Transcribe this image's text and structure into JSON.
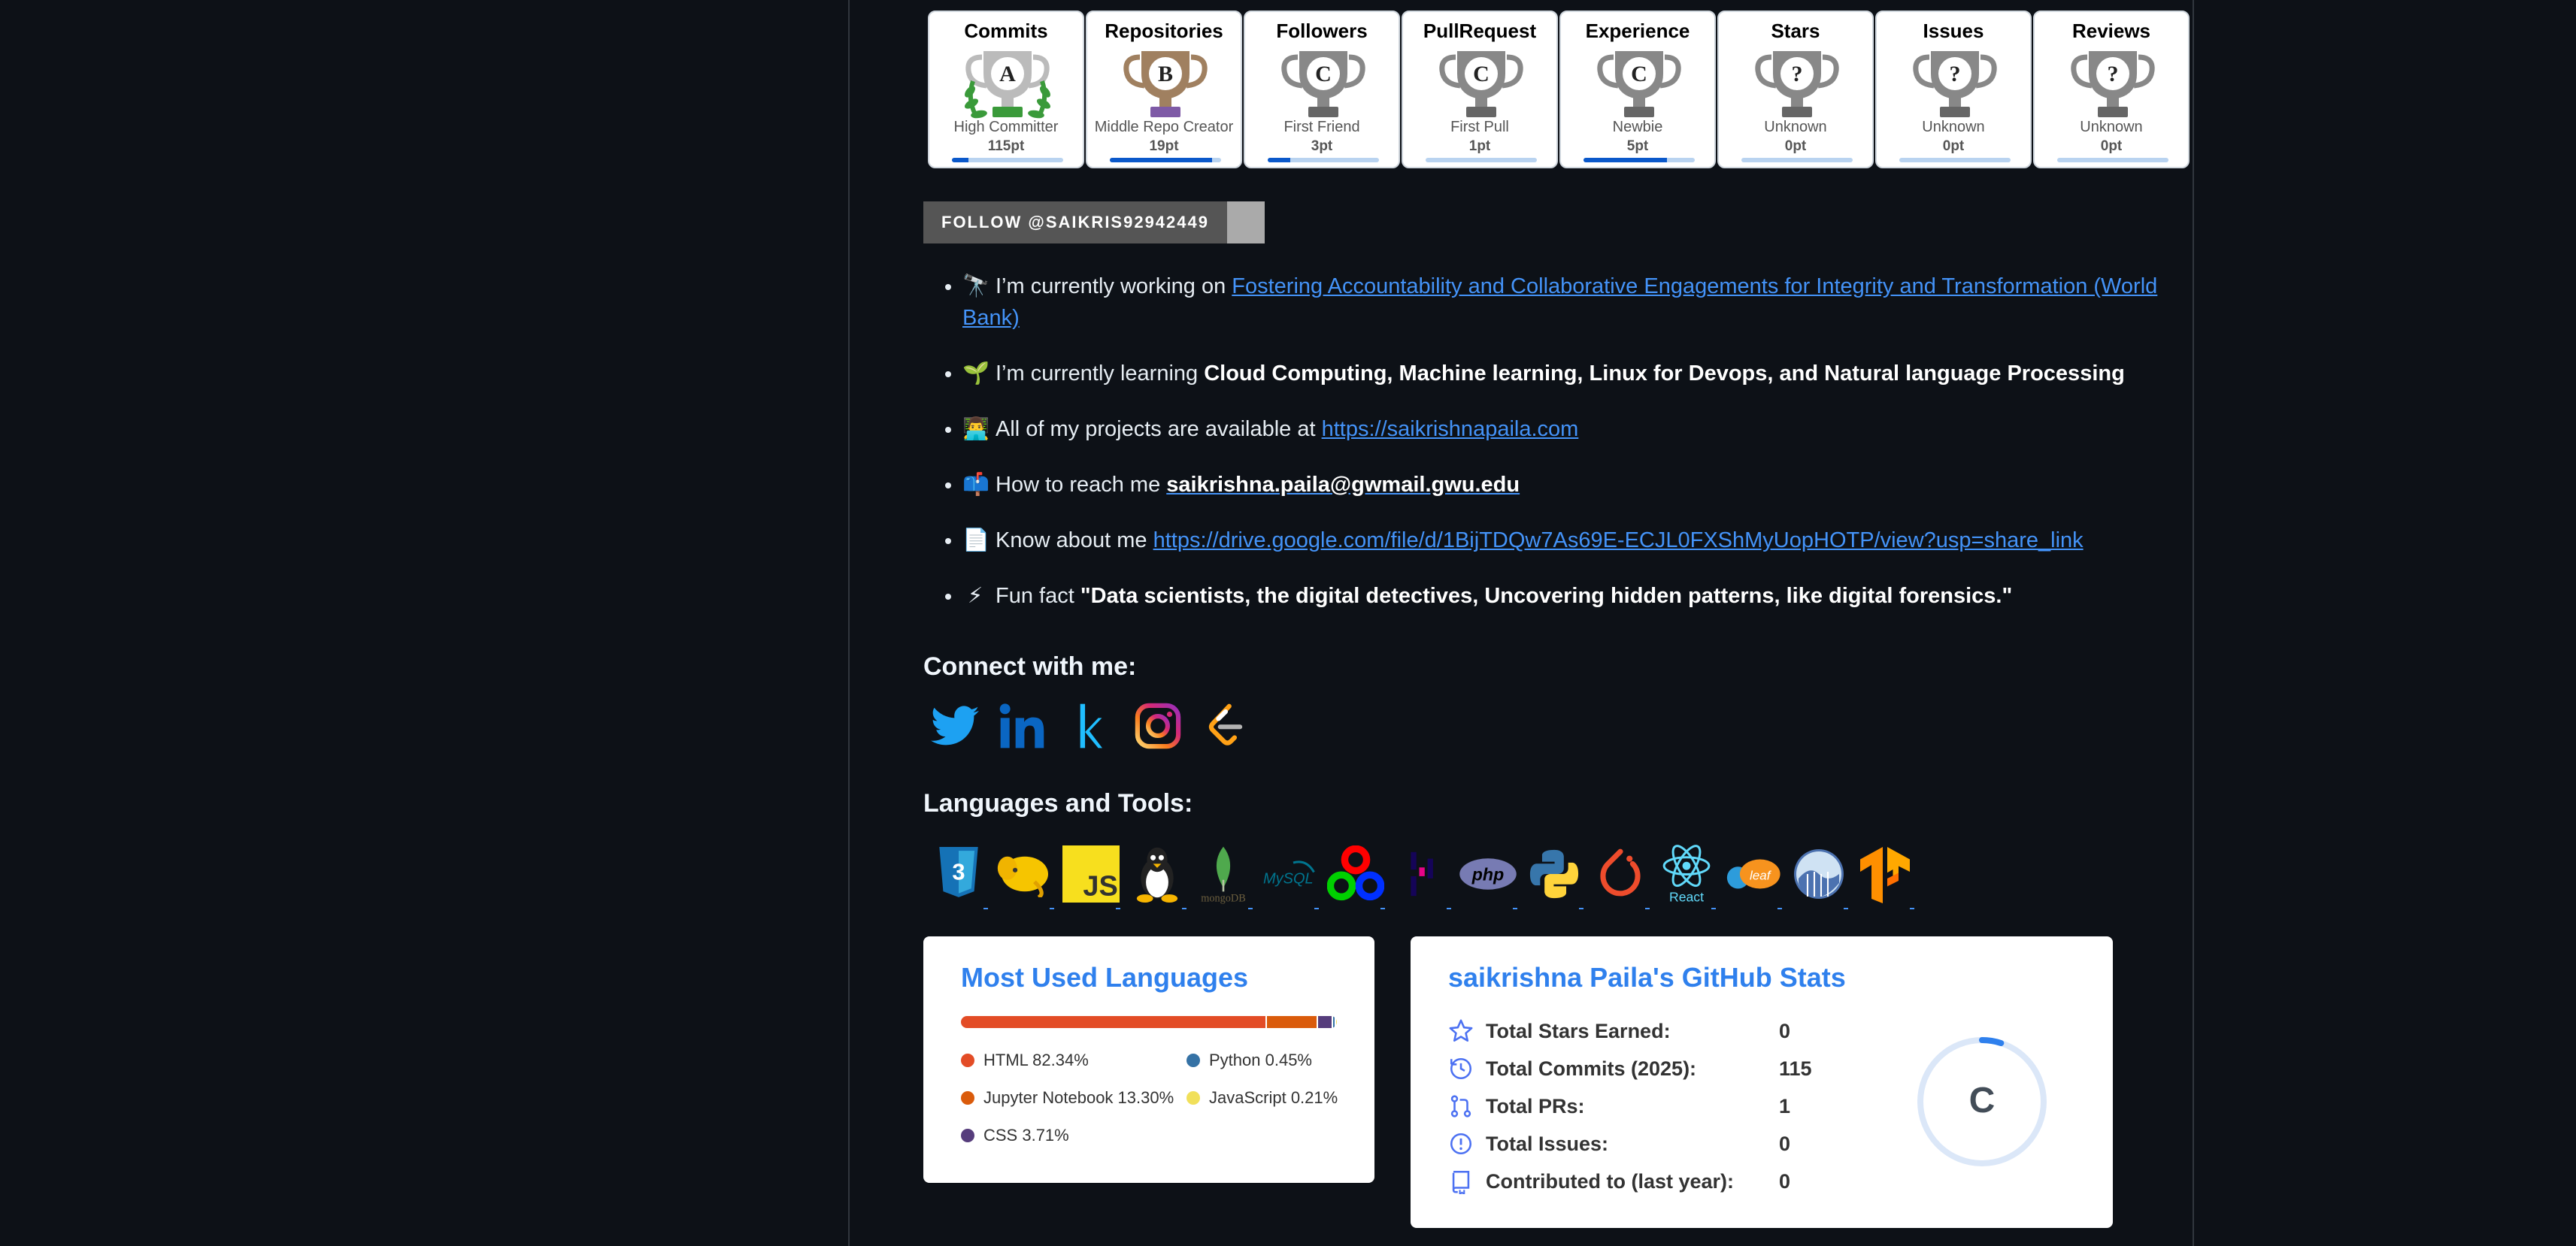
{
  "trophies": [
    {
      "title": "Commits",
      "rank": "A",
      "name": "High Committer",
      "points": "115pt",
      "progress": 0.15,
      "cup": "#bbb",
      "accent": "#3a9a3a",
      "laurel": true
    },
    {
      "title": "Repositories",
      "rank": "B",
      "name": "Middle Repo Creator",
      "points": "19pt",
      "progress": 0.92,
      "cup": "#a08060",
      "accent": "#7e5aa6",
      "laurel": false
    },
    {
      "title": "Followers",
      "rank": "C",
      "name": "First Friend",
      "points": "3pt",
      "progress": 0.2,
      "cup": "#888",
      "accent": "#666",
      "laurel": false
    },
    {
      "title": "PullRequest",
      "rank": "C",
      "name": "First Pull",
      "points": "1pt",
      "progress": 0.0,
      "cup": "#888",
      "accent": "#666",
      "laurel": false
    },
    {
      "title": "Experience",
      "rank": "C",
      "name": "Newbie",
      "points": "5pt",
      "progress": 0.75,
      "cup": "#888",
      "accent": "#666",
      "laurel": false
    },
    {
      "title": "Stars",
      "rank": "?",
      "name": "Unknown",
      "points": "0pt",
      "progress": 0.0,
      "cup": "#888",
      "accent": "#666",
      "laurel": false
    },
    {
      "title": "Issues",
      "rank": "?",
      "name": "Unknown",
      "points": "0pt",
      "progress": 0.0,
      "cup": "#888",
      "accent": "#666",
      "laurel": false
    },
    {
      "title": "Reviews",
      "rank": "?",
      "name": "Unknown",
      "points": "0pt",
      "progress": 0.0,
      "cup": "#888",
      "accent": "#666",
      "laurel": false
    }
  ],
  "follow_badge": "FOLLOW @SAIKRIS92942449",
  "about": {
    "working_prefix": "I’m currently working on ",
    "working_link": "Fostering Accountability and Collaborative Engagements for Integrity and Transformation (World Bank)",
    "learning_prefix": "I’m currently learning ",
    "learning_bold": "Cloud Computing, Machine learning, Linux for Devops, and Natural language Processing",
    "projects_prefix": "All of my projects are available at ",
    "projects_link": "https://saikrishnapaila.com",
    "reach_prefix": "How to reach me ",
    "reach_link": "saikrishna.paila@gwmail.gwu.edu",
    "know_prefix": "Know about me ",
    "know_link": "https://drive.google.com/file/d/1BijTDQw7As69E-ECJL0FXShMyUopHOTP/view?usp=share_link",
    "fun_prefix": "Fun fact ",
    "fun_bold": "\"Data scientists, the digital detectives, Uncovering hidden patterns, like digital forensics.\""
  },
  "connect_heading": "Connect with me:",
  "tools_heading": "Languages and Tools:",
  "tools": {
    "js": "JS",
    "mongodb": "mongoDB",
    "mysql": "MySQL",
    "php": "php",
    "react": "React",
    "leaf": "leaf"
  },
  "languages_card": {
    "title": "Most Used Languages",
    "langs": [
      {
        "name": "HTML",
        "percent": 82.34,
        "label": "HTML 82.34%",
        "color": "#e34c26"
      },
      {
        "name": "Jupyter Notebook",
        "percent": 13.3,
        "label": "Jupyter Notebook 13.30%",
        "color": "#DA5B0B"
      },
      {
        "name": "CSS",
        "percent": 3.71,
        "label": "CSS 3.71%",
        "color": "#563d7c"
      },
      {
        "name": "Python",
        "percent": 0.45,
        "label": "Python 0.45%",
        "color": "#3572A5"
      },
      {
        "name": "JavaScript",
        "percent": 0.21,
        "label": "JavaScript 0.21%",
        "color": "#f1e05a"
      }
    ]
  },
  "stats_card": {
    "title": "saikrishna Paila's GitHub Stats",
    "rows": [
      {
        "label": "Total Stars Earned:",
        "value": "0",
        "icon": "star-icon"
      },
      {
        "label": "Total Commits (2025):",
        "value": "115",
        "icon": "history-icon"
      },
      {
        "label": "Total PRs:",
        "value": "1",
        "icon": "pull-request-icon"
      },
      {
        "label": "Total Issues:",
        "value": "0",
        "icon": "issue-icon"
      },
      {
        "label": "Contributed to (last year):",
        "value": "0",
        "icon": "repo-icon"
      }
    ],
    "grade": "C",
    "grade_progress": 0.05,
    "accent": "#2f80ed"
  }
}
